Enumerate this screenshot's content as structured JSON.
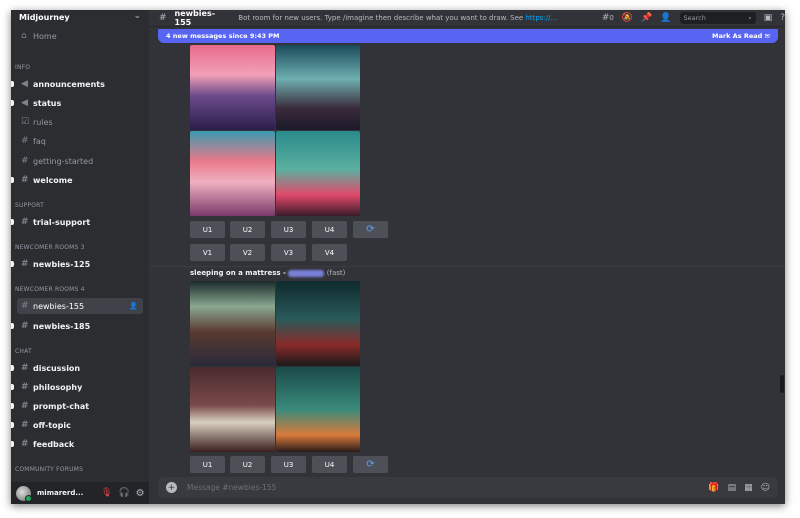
{
  "server": {
    "name": "Midjourney"
  },
  "sidebar": {
    "home": "Home",
    "categories": [
      "INFO",
      "SUPPORT",
      "NEWCOMER ROOMS 3",
      "NEWCOMER ROOMS 4",
      "CHAT",
      "COMMUNITY FORUMS"
    ],
    "channels": {
      "announcements": "announcements",
      "status": "status",
      "rules": "rules",
      "faq": "faq",
      "getting_started": "getting-started",
      "welcome": "welcome",
      "trial_support": "trial-support",
      "newbies_125": "newbies-125",
      "newbies_155": "newbies-155",
      "newbies_185": "newbies-185",
      "discussion": "discussion",
      "philosophy": "philosophy",
      "prompt_chat": "prompt-chat",
      "off_topic": "off-topic",
      "feedback": "feedback"
    }
  },
  "user": {
    "name": "mimarerd..."
  },
  "header": {
    "channel": "newbies-155",
    "topic": "Bot room for new users. Type /imagine then describe what you want to draw. See ",
    "topic_link": "https://...",
    "threads_count": "0",
    "search_placeholder": "Search"
  },
  "banner": {
    "text": "4 new messages since 9:43 PM",
    "action": "Mark As Read"
  },
  "messages": [
    {
      "buttons_u": [
        "U1",
        "U2",
        "U3",
        "U4"
      ],
      "buttons_v": [
        "V1",
        "V2",
        "V3",
        "V4"
      ]
    },
    {
      "prompt": "sleeping on a mattress - ",
      "mode": "(fast)",
      "buttons_u": [
        "U1",
        "U2",
        "U3",
        "U4"
      ]
    }
  ],
  "input": {
    "placeholder": "Message #newbies-155"
  }
}
